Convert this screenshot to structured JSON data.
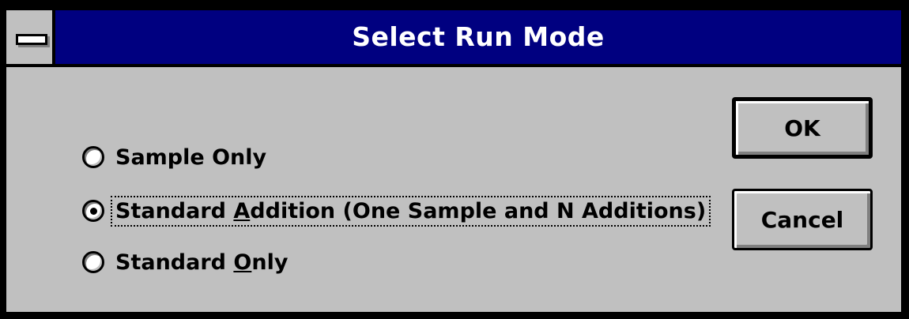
{
  "window": {
    "title": "Select Run Mode"
  },
  "options": [
    {
      "label_before": "Sample Only",
      "mnemonic": "",
      "label_after": "",
      "selected": false
    },
    {
      "label_before": "Standard ",
      "mnemonic": "A",
      "label_after": "ddition (One Sample and N Additions)",
      "selected": true
    },
    {
      "label_before": "Standard ",
      "mnemonic": "O",
      "label_after": "nly",
      "selected": false
    }
  ],
  "buttons": {
    "ok": "OK",
    "cancel": "Cancel"
  },
  "colors": {
    "titlebar": "#000080",
    "face": "#c0c0c0",
    "title_text": "#ffffff"
  }
}
